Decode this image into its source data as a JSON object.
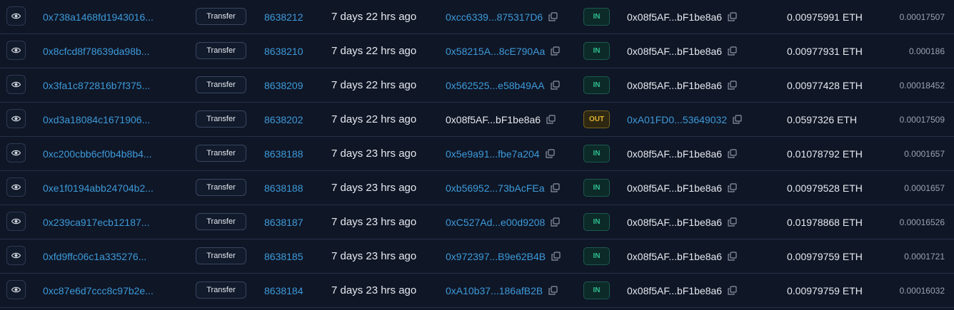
{
  "rows": [
    {
      "hash": "0x738a1468fd1943016...",
      "method": "Transfer",
      "block": "8638212",
      "age": "7 days 22 hrs ago",
      "from": "0xcc6339...875317D6",
      "direction": "IN",
      "to": "0x08f5AF...bF1be8a6",
      "value": "0.00975991 ETH",
      "fee": "0.00017507"
    },
    {
      "hash": "0x8cfcd8f78639da98b...",
      "method": "Transfer",
      "block": "8638210",
      "age": "7 days 22 hrs ago",
      "from": "0x58215A...8cE790Aa",
      "direction": "IN",
      "to": "0x08f5AF...bF1be8a6",
      "value": "0.00977931 ETH",
      "fee": "0.000186"
    },
    {
      "hash": "0x3fa1c872816b7f375...",
      "method": "Transfer",
      "block": "8638209",
      "age": "7 days 22 hrs ago",
      "from": "0x562525...e58b49AA",
      "direction": "IN",
      "to": "0x08f5AF...bF1be8a6",
      "value": "0.00977428 ETH",
      "fee": "0.00018452"
    },
    {
      "hash": "0xd3a18084c1671906...",
      "method": "Transfer",
      "block": "8638202",
      "age": "7 days 22 hrs ago",
      "from": "0x08f5AF...bF1be8a6",
      "direction": "OUT",
      "to": "0xA01FD0...53649032",
      "value": "0.0597326 ETH",
      "fee": "0.00017509"
    },
    {
      "hash": "0xc200cbb6cf0b4b8b4...",
      "method": "Transfer",
      "block": "8638188",
      "age": "7 days 23 hrs ago",
      "from": "0x5e9a91...fbe7a204",
      "direction": "IN",
      "to": "0x08f5AF...bF1be8a6",
      "value": "0.01078792 ETH",
      "fee": "0.0001657"
    },
    {
      "hash": "0xe1f0194abb24704b2...",
      "method": "Transfer",
      "block": "8638188",
      "age": "7 days 23 hrs ago",
      "from": "0xb56952...73bAcFEa",
      "direction": "IN",
      "to": "0x08f5AF...bF1be8a6",
      "value": "0.00979528 ETH",
      "fee": "0.0001657"
    },
    {
      "hash": "0x239ca917ecb12187...",
      "method": "Transfer",
      "block": "8638187",
      "age": "7 days 23 hrs ago",
      "from": "0xC527Ad...e00d9208",
      "direction": "IN",
      "to": "0x08f5AF...bF1be8a6",
      "value": "0.01978868 ETH",
      "fee": "0.00016526"
    },
    {
      "hash": "0xfd9ffc06c1a335276...",
      "method": "Transfer",
      "block": "8638185",
      "age": "7 days 23 hrs ago",
      "from": "0x972397...B9e62B4B",
      "direction": "IN",
      "to": "0x08f5AF...bF1be8a6",
      "value": "0.00979759 ETH",
      "fee": "0.0001721"
    },
    {
      "hash": "0xc87e6d7ccc8c97b2e...",
      "method": "Transfer",
      "block": "8638184",
      "age": "7 days 23 hrs ago",
      "from": "0xA10b37...186afB2B",
      "direction": "IN",
      "to": "0x08f5AF...bF1be8a6",
      "value": "0.00979759 ETH",
      "fee": "0.00016032"
    }
  ],
  "owner_address": "0x08f5AF...bF1be8a6",
  "icons": {
    "view": "eye-icon",
    "copy": "copy-icon"
  },
  "colors": {
    "background": "#0f1626",
    "link": "#3d9ad9",
    "in_badge": "#2fbf8f",
    "out_badge": "#e0b230",
    "divider": "#263148"
  }
}
